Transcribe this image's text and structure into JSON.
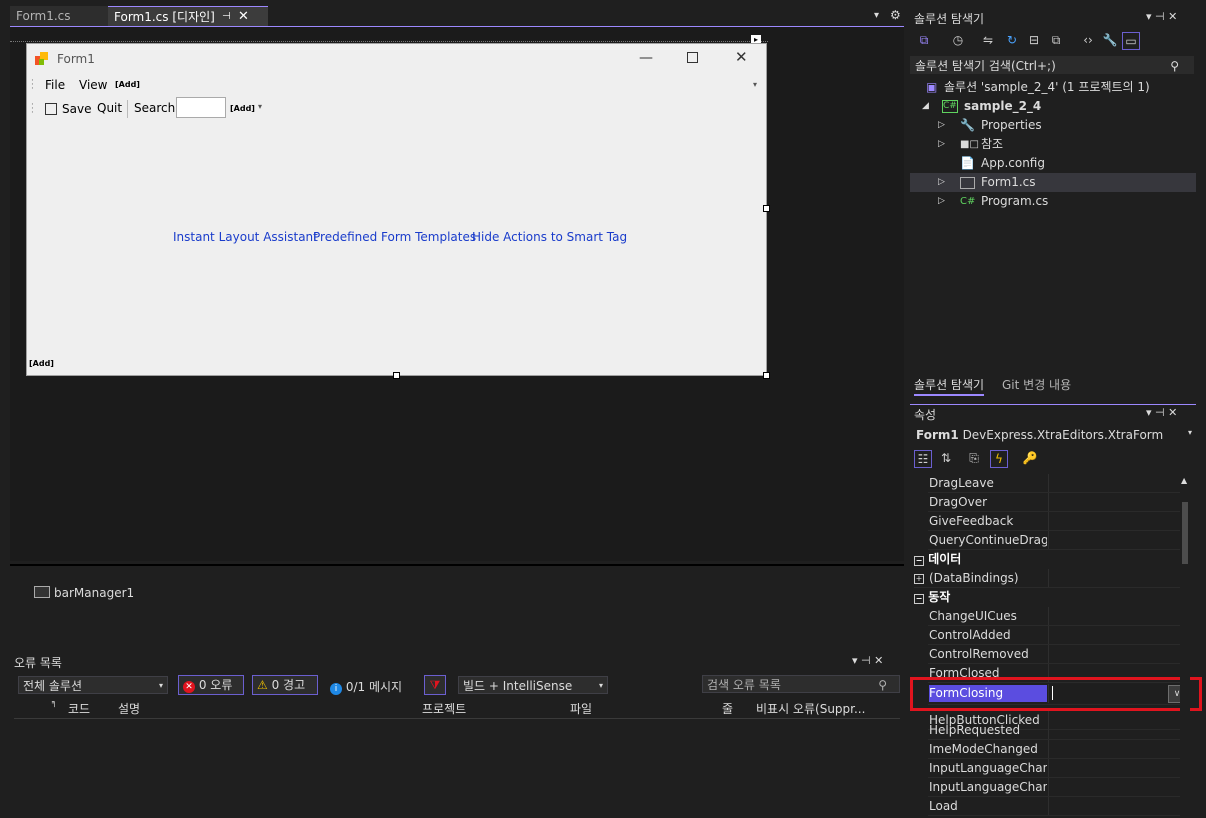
{
  "tabs": [
    {
      "label": "Form1.cs"
    },
    {
      "label": "Form1.cs [디자인]"
    }
  ],
  "form": {
    "title": "Form1",
    "menu": {
      "file": "File",
      "view": "View",
      "add": "[Add]"
    },
    "toolbar": {
      "save": "Save",
      "quit": "Quit",
      "search": "Search",
      "add": "[Add]"
    },
    "links": [
      "Instant Layout Assistant",
      "Predefined Form Templates",
      "Hide Actions to Smart Tag"
    ],
    "status_add": "[Add]"
  },
  "tray": {
    "component": "barManager1"
  },
  "error_list": {
    "title": "오류 목록",
    "scope": "전체 솔루션",
    "errors": "0 오류",
    "warnings": "0 경고",
    "messages": "0/1 메시지",
    "build_filter": "빌드 + IntelliSense",
    "search_placeholder": "검색 오류 목록",
    "columns": [
      "코드",
      "설명",
      "프로젝트",
      "파일",
      "줄",
      "비표시 오류(Suppr..."
    ]
  },
  "solution_explorer": {
    "title": "솔루션 탐색기",
    "search_placeholder": "솔루션 탐색기 검색(Ctrl+;)",
    "items": [
      {
        "label": "솔루션 'sample_2_4'  (1 프로젝트의 1)"
      },
      {
        "label": "sample_2_4"
      },
      {
        "label": "Properties"
      },
      {
        "label": "참조"
      },
      {
        "label": "App.config"
      },
      {
        "label": "Form1.cs"
      },
      {
        "label": "Program.cs"
      }
    ],
    "bottom_tabs": [
      "솔루션 탐색기",
      "Git 변경 내용"
    ]
  },
  "properties": {
    "title": "속성",
    "object_name": "Form1",
    "object_type": "DevExpress.XtraEditors.XtraForm",
    "rows": [
      {
        "name": "DragLeave"
      },
      {
        "name": "DragOver"
      },
      {
        "name": "GiveFeedback"
      },
      {
        "name": "QueryContinueDrag"
      }
    ],
    "category_data": "데이터",
    "databindings": "(DataBindings)",
    "category_action": "동작",
    "rows2": [
      {
        "name": "ChangeUICues"
      },
      {
        "name": "ControlAdded"
      },
      {
        "name": "ControlRemoved"
      },
      {
        "name": "FormClosed"
      },
      {
        "name": "FormClosing"
      },
      {
        "name": "HelpButtonClicked"
      },
      {
        "name": "HelpRequested"
      },
      {
        "name": "ImeModeChanged"
      },
      {
        "name": "InputLanguageChange"
      },
      {
        "name": "InputLanguageChangi"
      },
      {
        "name": "Load"
      }
    ]
  },
  "colors": {
    "accent": "#6b5fd0",
    "selected": "#5b4de0",
    "highlight_box": "#e0141e"
  }
}
